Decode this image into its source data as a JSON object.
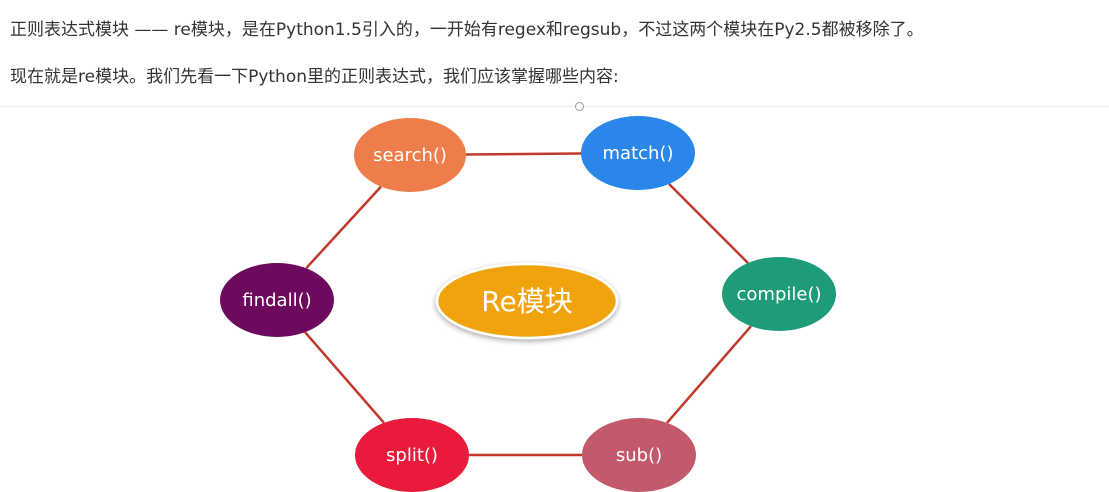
{
  "text": {
    "line1": "正则表达式模块 —— re模块，是在Python1.5引入的，一开始有regex和regsub，不过这两个模块在Py2.5都被移除了。",
    "line2": "现在就是re模块。我们先看一下Python里的正则表达式，我们应该掌握哪些内容:"
  },
  "diagram": {
    "center": {
      "label": "Re模块",
      "color": "#f0a30a"
    },
    "edge_color": "#c0392b",
    "nodes": [
      {
        "id": "search",
        "label": "search()",
        "color": "#ed7d4a"
      },
      {
        "id": "match",
        "label": "match()",
        "color": "#2a86e8"
      },
      {
        "id": "compile",
        "label": "compile()",
        "color": "#1e9c7a"
      },
      {
        "id": "sub",
        "label": "sub()",
        "color": "#c25a6b"
      },
      {
        "id": "split",
        "label": "split()",
        "color": "#ea1a3c"
      },
      {
        "id": "findall",
        "label": "findall()",
        "color": "#6e0a5e"
      }
    ]
  }
}
